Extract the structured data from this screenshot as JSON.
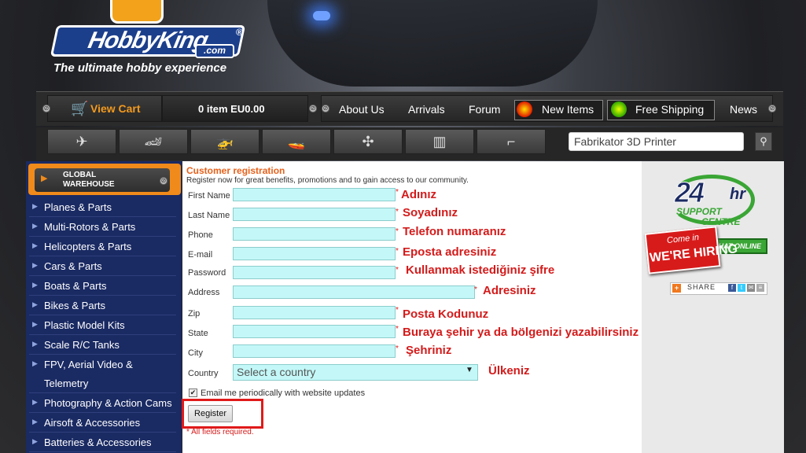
{
  "logo": {
    "word": "HobbyKing",
    "domain": ".com",
    "reg": "®",
    "tagline": "The ultimate hobby experience"
  },
  "nav": {
    "cart_label": "View Cart",
    "cart_status": "0 item EU0.00",
    "links": [
      "About Us",
      "Arrivals",
      "Forum",
      "New Items",
      "Free Shipping",
      "News"
    ]
  },
  "search": {
    "value": "Fabrikator 3D Printer"
  },
  "sidebar": {
    "global_warehouse": "GLOBAL WAREHOUSE",
    "items": [
      "Planes & Parts",
      "Multi-Rotors & Parts",
      "Helicopters & Parts",
      "Cars & Parts",
      "Boats & Parts",
      "Bikes & Parts",
      "Plastic Model Kits",
      "Scale R/C Tanks",
      "FPV, Aerial Video &",
      "Telemetry",
      "Photography & Action Cams",
      "Airsoft & Accessories",
      "Batteries & Accessories"
    ]
  },
  "form": {
    "title": "Customer registration",
    "subtitle": "Register now for great benefits, promotions and to gain access to our community.",
    "fields": [
      {
        "label": "First Name",
        "note": "Adınız"
      },
      {
        "label": "Last Name",
        "note": "Soyadınız"
      },
      {
        "label": "Phone",
        "note": "Telefon numaranız"
      },
      {
        "label": "E-mail",
        "note": "Eposta adresiniz"
      },
      {
        "label": "Password",
        "note": "Kullanmak istediğiniz şifre"
      },
      {
        "label": "Address",
        "note": "Adresiniz"
      },
      {
        "label": "Zip",
        "note": "Posta Kodunuz"
      },
      {
        "label": "State",
        "note": "Buraya şehir ya da bölgenizi yazabilirsiniz"
      },
      {
        "label": "City",
        "note": "Şehriniz"
      }
    ],
    "country_label": "Country",
    "country_value": "Select a country",
    "country_note": "Ülkeniz",
    "required_mark": "*",
    "email_updates": "Email me periodically with website updates",
    "register_label": "Register",
    "required_note": "* All fields required."
  },
  "right": {
    "support_24": "24",
    "support_hr": "hr",
    "support_word": "SUPPORT",
    "centre_word": "CENTRE",
    "chat_online": "CHAT ONLINE",
    "hiring_top": "Come in",
    "hiring_bottom": "WE'RE HIRING",
    "share": "SHARE"
  },
  "colors": {
    "accent_orange": "#f39a1e",
    "sidebar_blue": "#1a2a63",
    "input_cyan": "#c4f8f8",
    "annotation_red": "#d41b1b"
  }
}
